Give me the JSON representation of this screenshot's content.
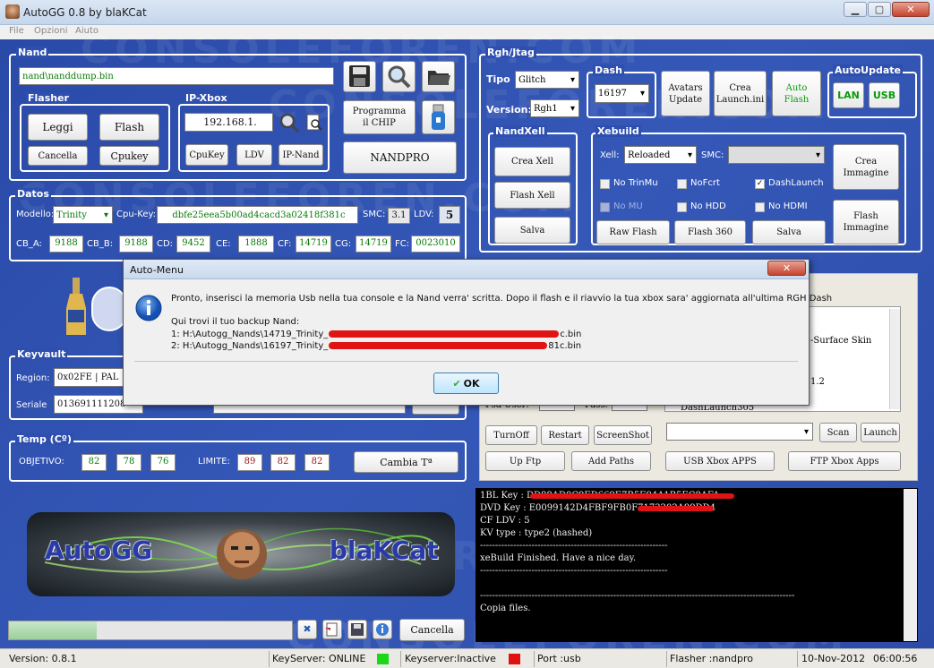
{
  "window": {
    "title": "AutoGG 0.8 by blaKCat",
    "minimize": "▁",
    "maximize": "▢",
    "close": "✕"
  },
  "menu": [
    "File",
    "Opzioni",
    "Aiuto"
  ],
  "nand": {
    "title": "Nand",
    "path": "nand\\nanddump.bin",
    "flasher_title": "Flasher",
    "flasher_buttons": [
      "Leggi",
      "Flash",
      "Cancella",
      "Cpukey"
    ],
    "ipxbox_title": "IP-Xbox",
    "ip": "192.168.1.",
    "ip_buttons": [
      "CpuKey",
      "LDV",
      "IP-Nand"
    ],
    "program_chip": [
      "Programma",
      "il CHIP"
    ],
    "nandpro": "NANDPRO"
  },
  "datos": {
    "title": "Datos",
    "modello_label": "Modello:",
    "modello": "Trinity",
    "cpukey_label": "Cpu-Key:",
    "cpukey": "dbfe25eea5b00ad4cacd3a02418f381c",
    "smc_label": "SMC:",
    "smc": "3.1",
    "ldv_label": "LDV:",
    "ldv": "5",
    "cb": [
      {
        "label": "CB_A:",
        "value": "9188"
      },
      {
        "label": "CB_B:",
        "value": "9188"
      },
      {
        "label": "CD:",
        "value": "9452"
      },
      {
        "label": "CE:",
        "value": "1888"
      },
      {
        "label": "CF:",
        "value": "14719"
      },
      {
        "label": "CG:",
        "value": "14719"
      },
      {
        "label": "FC:",
        "value": "0023010"
      }
    ]
  },
  "rgh": {
    "title": "Rgh/Jtag",
    "tipo_label": "Tipo",
    "tipo": "Glitch",
    "version_label": "Version:",
    "version": "Rgh1",
    "dash_title": "Dash",
    "dash": "16197",
    "avatars_update": [
      "Avatars",
      "Update"
    ],
    "crea_launch": [
      "Crea",
      "Launch.ini"
    ],
    "auto_flash": [
      "Auto",
      "Flash"
    ],
    "autoupdate_title": "AutoUpdate",
    "lan": "LAN",
    "usb": "USB",
    "nandxell_title": "NandXell",
    "nandxell_buttons": [
      "Crea Xell",
      "Flash Xell",
      "Salva"
    ],
    "xebuild_title": "Xebuild",
    "xell_label": "Xell:",
    "xell": "Reloaded",
    "smc_label": "SMC:",
    "options": [
      {
        "label": "No TrinMu",
        "checked": false,
        "enabled": true
      },
      {
        "label": "NoFcrt",
        "checked": false,
        "enabled": true
      },
      {
        "label": "DashLaunch",
        "checked": true,
        "enabled": true
      },
      {
        "label": "No MU",
        "checked": false,
        "enabled": false
      },
      {
        "label": "No HDD",
        "checked": false,
        "enabled": true
      },
      {
        "label": "No HDMI",
        "checked": false,
        "enabled": true
      }
    ],
    "crea_immagine": [
      "Crea",
      "Immagine"
    ],
    "flash_immagine": [
      "Flash",
      "Immagine"
    ],
    "xebuild_buttons": [
      "Raw Flash",
      "Flash 360",
      "Salva"
    ]
  },
  "keyvault": {
    "title": "Keyvault",
    "region_label": "Region:",
    "region": "0x02FE  |  PAL",
    "seriale_label": "Seriale",
    "seriale": "013691111208"
  },
  "temp": {
    "title": "Temp (Cº)",
    "objetivo_label": "OBJETIVO:",
    "objetivo": [
      "82",
      "78",
      "76"
    ],
    "limite_label": "LIMITE:",
    "limite": [
      "89",
      "82",
      "82"
    ],
    "cambia": "Cambia Tª"
  },
  "ftp": {
    "skin_item": "-Surface Skin",
    "item2": "1.2",
    "psd_user": "Psd User:",
    "pass": "Pass:",
    "dashlaunch": "DashLaunch305",
    "scan": "Scan",
    "launch": "Launch",
    "buttons_row1": [
      "TurnOff",
      "Restart",
      "ScreenShot"
    ],
    "buttons_row2": [
      "Up Ftp",
      "Add Paths",
      "USB Xbox APPS",
      "FTP Xbox Apps"
    ]
  },
  "console_lines": [
    "1BL Key   :  DD88AD0C9ED669E7B5E94A1B5EC8AFA",
    "DVD Key   :  E0099142D4FBF9FB0F7173202A99DD4",
    "CF LDV    :  5",
    "KV type   :  type2 (hashed)",
    "--------------------------------------------------------------",
    "    xeBuild Finished. Have a nice day.",
    "--------------------------------------------------------------",
    "",
    "--------------------------------------------------------------------------------------------------------",
    "Copia files."
  ],
  "banner": {
    "left": "AutoGG",
    "right": "blaKCat"
  },
  "bottom": {
    "cancella": "Cancella",
    "progress": 0.31
  },
  "watermark": "CONSOLEFOREN.COM",
  "status": {
    "version": "Version: 0.8.1",
    "keyserver": "KeyServer: ONLINE",
    "keyserver_inactive": "Keyserver:Inactive",
    "port": "Port :usb",
    "flasher": "Flasher :nandpro",
    "date": "10-Nov-2012",
    "time": "06:00:56",
    "green": "#18d818",
    "red": "#e01010"
  },
  "dialog": {
    "title": "Auto-Menu",
    "close": "✕",
    "message": "Pronto, inserisci la memoria Usb nella tua console e la Nand verra' scritta. Dopo il flash e il riavvio la tua xbox  sara' aggiornata all'ultima RGH Dash",
    "backup_label": "Qui trovi il tuo backup Nand:",
    "line1_prefix": "1: H:\\Autogg_Nands\\14719_Trinity_",
    "line1_suffix": "c.bin",
    "line2_prefix": "2: H:\\Autogg_Nands\\16197_Trinity_",
    "line2_suffix": "81c.bin",
    "ok": "OK"
  }
}
